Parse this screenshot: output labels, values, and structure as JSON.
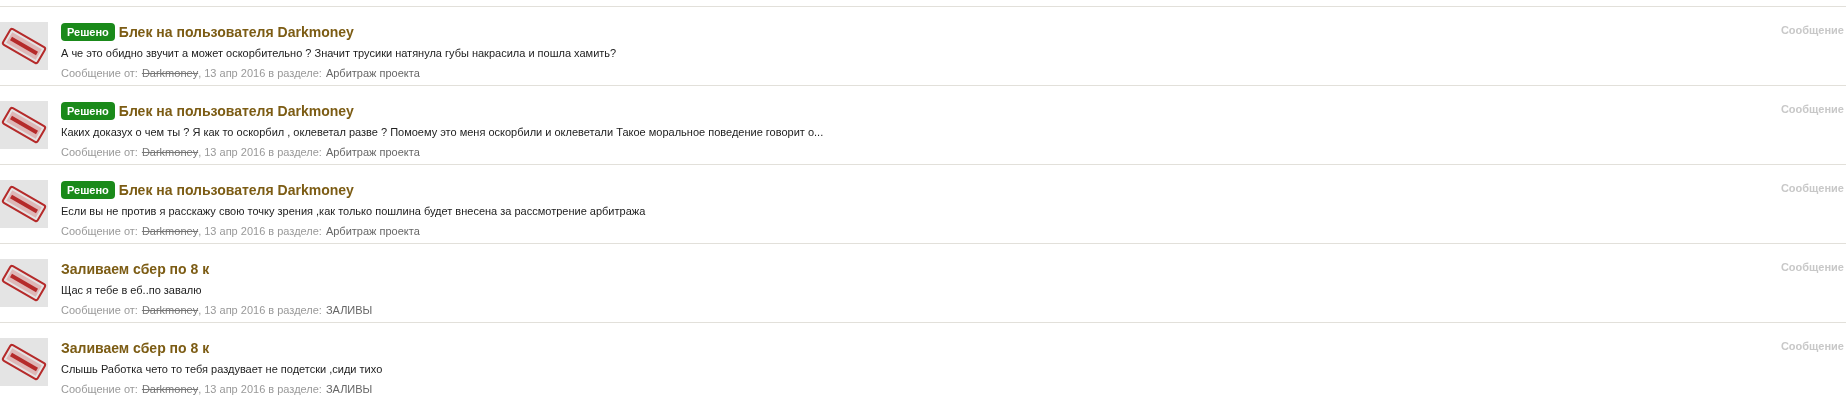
{
  "results": [
    {
      "prefix": "Решено",
      "title": "Блек на пользователя Darkmoney",
      "snippet": "А че это обидно звучит а может оскорбительно ? Значит трусики натянула губы накрасила и пошла хамить?",
      "meta_label": "Сообщение от:",
      "author": "Darkmoney",
      "date": ", 13 апр 2016 в разделе:",
      "section": "Арбитраж проекта",
      "type_label": "Сообщение"
    },
    {
      "prefix": "Решено",
      "title": "Блек на пользователя Darkmoney",
      "snippet": "Каких доказух о чем ты ? Я как то оскорбил , оклеветал разве ? Помоему это меня оскорбили и оклеветали Такое моральное поведение говорит о...",
      "meta_label": "Сообщение от:",
      "author": "Darkmoney",
      "date": ", 13 апр 2016 в разделе:",
      "section": "Арбитраж проекта",
      "type_label": "Сообщение"
    },
    {
      "prefix": "Решено",
      "title": "Блек на пользователя Darkmoney",
      "snippet": "Если вы не против я расскажу свою точку зрения ,как только пошлина будет внесена за рассмотрение арбитража",
      "meta_label": "Сообщение от:",
      "author": "Darkmoney",
      "date": ", 13 апр 2016 в разделе:",
      "section": "Арбитраж проекта",
      "type_label": "Сообщение"
    },
    {
      "title": "Заливаем сбер по 8 к",
      "snippet": "Щас я тебе в еб..по завалю",
      "meta_label": "Сообщение от:",
      "author": "Darkmoney",
      "date": ", 13 апр 2016 в разделе:",
      "section": "ЗАЛИВЫ",
      "type_label": "Сообщение"
    },
    {
      "title": "Заливаем сбер по 8 к",
      "snippet": "Слышь Работка чето то тебя раздувает не подетски ,сиди тихо",
      "meta_label": "Сообщение от:",
      "author": "Darkmoney",
      "date": ", 13 апр 2016 в разделе:",
      "section": "ЗАЛИВЫ",
      "type_label": "Сообщение"
    }
  ]
}
